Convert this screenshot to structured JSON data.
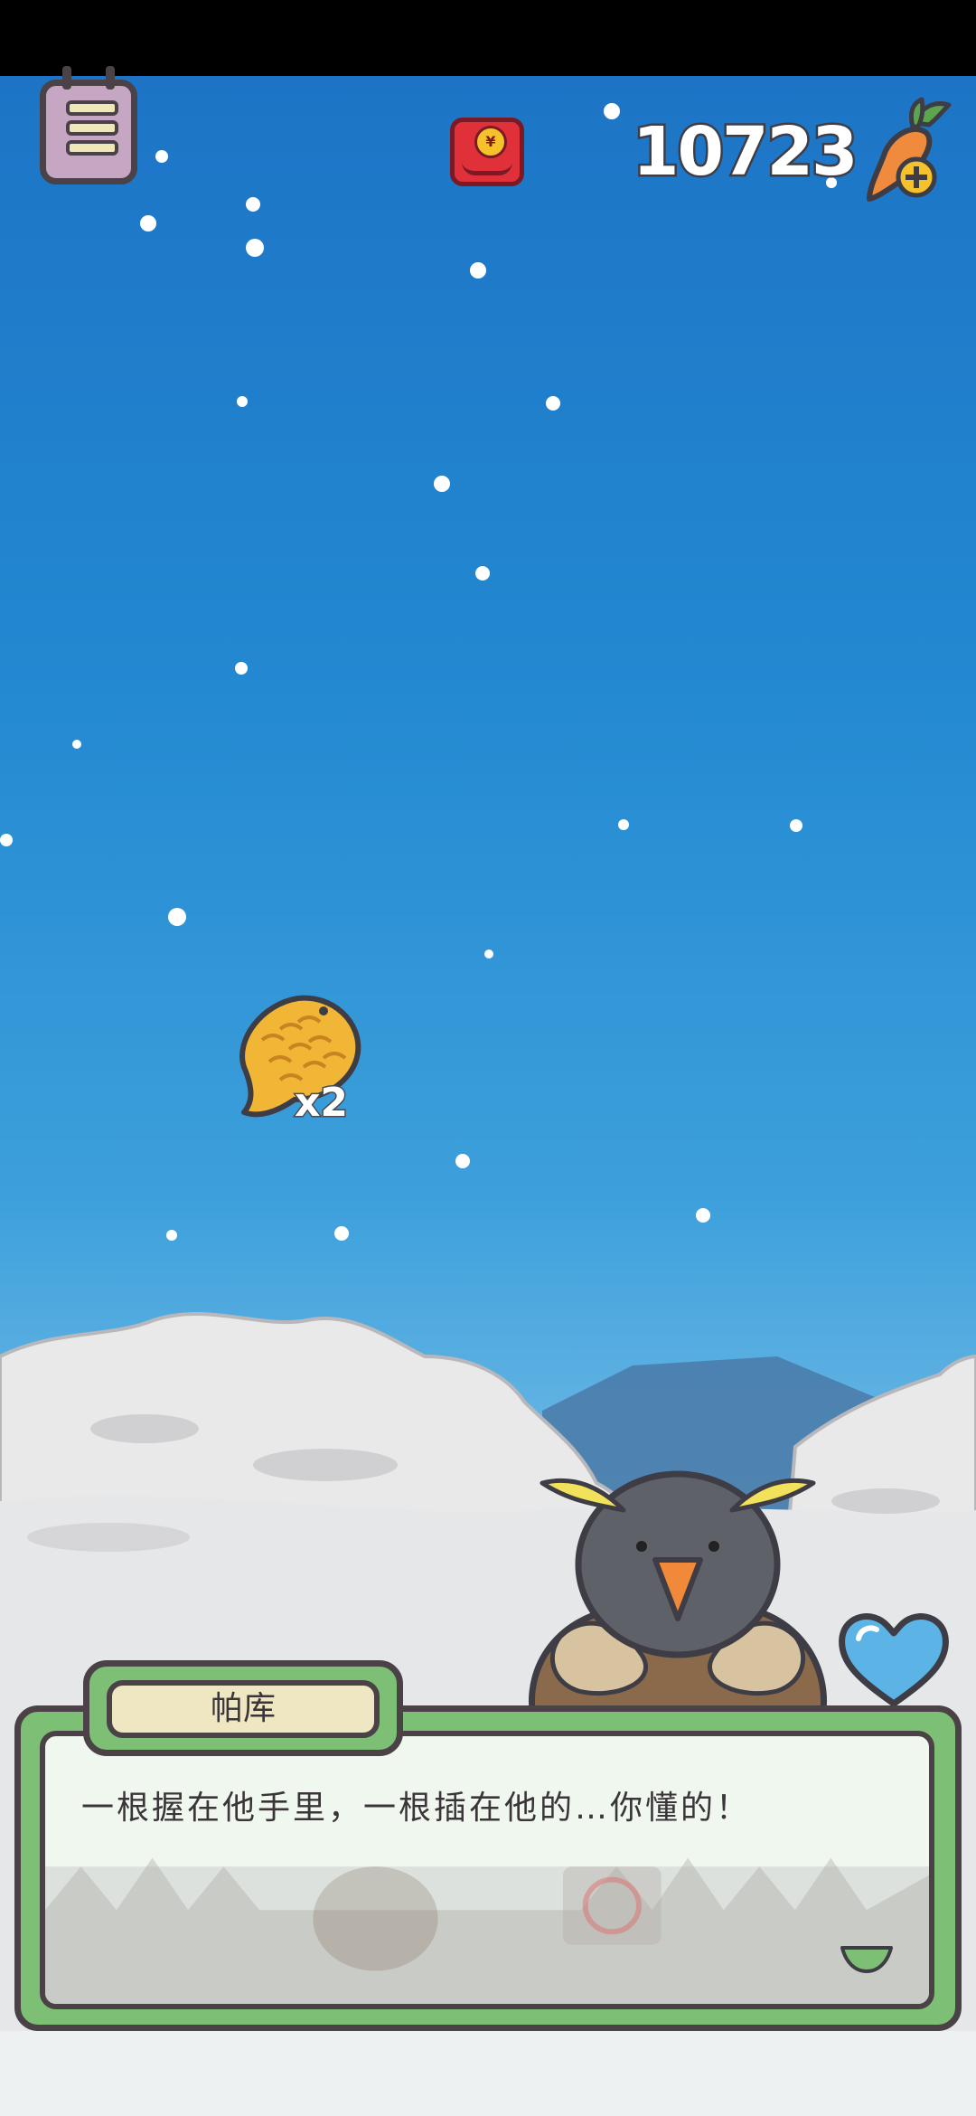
{
  "hud": {
    "carrot_count": "10723",
    "red_packet_symbol": "¥"
  },
  "reward": {
    "item_icon": "taiyaki-fish-icon",
    "multiplier": "x2"
  },
  "dialog": {
    "speaker_name": "帕库",
    "text": "一根握在他手里，一根插在他的…你懂的！"
  },
  "colors": {
    "sky_top": "#1d74c6",
    "dialog_frame": "#7dbf74",
    "outline": "#4a4246",
    "heart": "#5bb3e6",
    "red_packet": "#e0313b"
  },
  "icons": {
    "menu": "menu-icon",
    "red_packet": "red-envelope-icon",
    "carrot_add": "carrot-add-icon",
    "heart": "heart-icon",
    "next": "next-arrow-icon"
  }
}
